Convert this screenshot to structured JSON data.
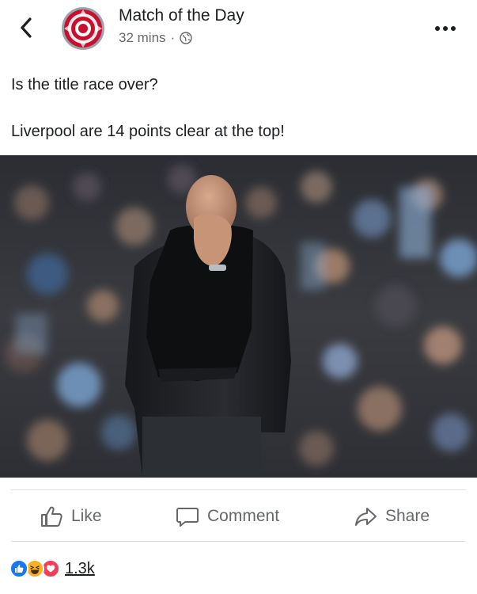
{
  "header": {
    "page_name": "Match of the Day",
    "time": "32 mins",
    "separator": "·",
    "back_icon": "chevron-left-icon",
    "privacy_icon": "globe-icon",
    "more_icon": "more-horizontal-icon"
  },
  "post": {
    "line1": "Is the title race over?",
    "line2": "Liverpool are 14 points clear at the top!"
  },
  "actions": {
    "like": "Like",
    "comment": "Comment",
    "share": "Share"
  },
  "reactions": {
    "count": "1.3k",
    "types": [
      "like",
      "haha",
      "love"
    ]
  },
  "colors": {
    "text": "#1c1e21",
    "secondary": "#65676b",
    "divider": "#dddfe2",
    "like_blue": "#1877f2",
    "love_red": "#f33e58",
    "haha_yellow": "#f7b125"
  }
}
